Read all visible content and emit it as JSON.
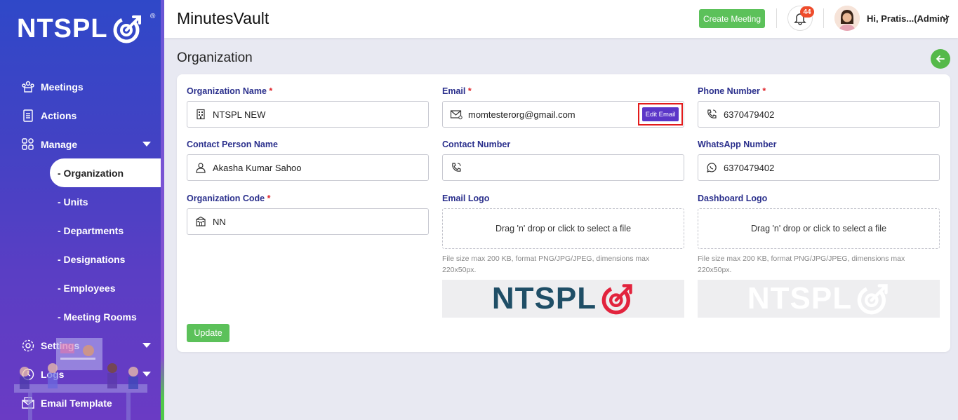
{
  "brand": {
    "logo_text": "NTSPL",
    "reg_mark": "®"
  },
  "header": {
    "app_title": "MinutesVault",
    "create_meeting_label": "Create Meeting",
    "notifications_count": "44",
    "user_label": "Hi, Pratis...(Admin)"
  },
  "sidebar": {
    "items": [
      {
        "label": "Meetings",
        "icon": "meetings-icon"
      },
      {
        "label": "Actions",
        "icon": "actions-icon"
      },
      {
        "label": "Manage",
        "icon": "manage-icon"
      }
    ],
    "manage_sub": [
      {
        "label": "- Organization"
      },
      {
        "label": "- Units"
      },
      {
        "label": "- Departments"
      },
      {
        "label": "- Designations"
      },
      {
        "label": "- Employees"
      },
      {
        "label": "- Meeting Rooms"
      }
    ],
    "bottom_items": [
      {
        "label": "Settings",
        "icon": "gear-icon"
      },
      {
        "label": "Logs",
        "icon": "clock-icon"
      },
      {
        "label": "Email Template",
        "icon": "email-template-icon"
      }
    ]
  },
  "page": {
    "title": "Organization"
  },
  "form": {
    "org_name": {
      "label": "Organization Name",
      "required": "*",
      "value": "NTSPL NEW"
    },
    "email": {
      "label": "Email",
      "required": "*",
      "value": "momtesterorg@gmail.com",
      "edit_label": "Edit Email"
    },
    "phone": {
      "label": "Phone Number",
      "required": "*",
      "value": "6370479402"
    },
    "contact_person": {
      "label": "Contact Person Name",
      "value": "Akasha Kumar Sahoo"
    },
    "contact_number": {
      "label": "Contact Number",
      "value": ""
    },
    "whatsapp": {
      "label": "WhatsApp Number",
      "value": "6370479402"
    },
    "org_code": {
      "label": "Organization Code",
      "required": "*",
      "value": "NN"
    },
    "email_logo": {
      "label": "Email Logo",
      "drop_text": "Drag 'n' drop or click to select a file",
      "hint": "File size max 200 KB, format PNG/JPG/JPEG, dimensions max 220x50px.",
      "preview_text": "NTSPL"
    },
    "dashboard_logo": {
      "label": "Dashboard Logo",
      "drop_text": "Drag 'n' drop or click to select a file",
      "hint": "File size max 200 KB, format PNG/JPG/JPEG, dimensions max 220x50px.",
      "preview_text": "NTSPL"
    },
    "update_label": "Update"
  },
  "colors": {
    "sidebar_top": "#2f48c8",
    "sidebar_bottom": "#6a3bc4",
    "accent_green": "#5cc15a",
    "label_navy": "#2a2f8c",
    "required_red": "#e0262c",
    "edit_email_purple": "#5b36c8",
    "logo_teal": "#1f4e66",
    "logo_red": "#e2233d"
  }
}
